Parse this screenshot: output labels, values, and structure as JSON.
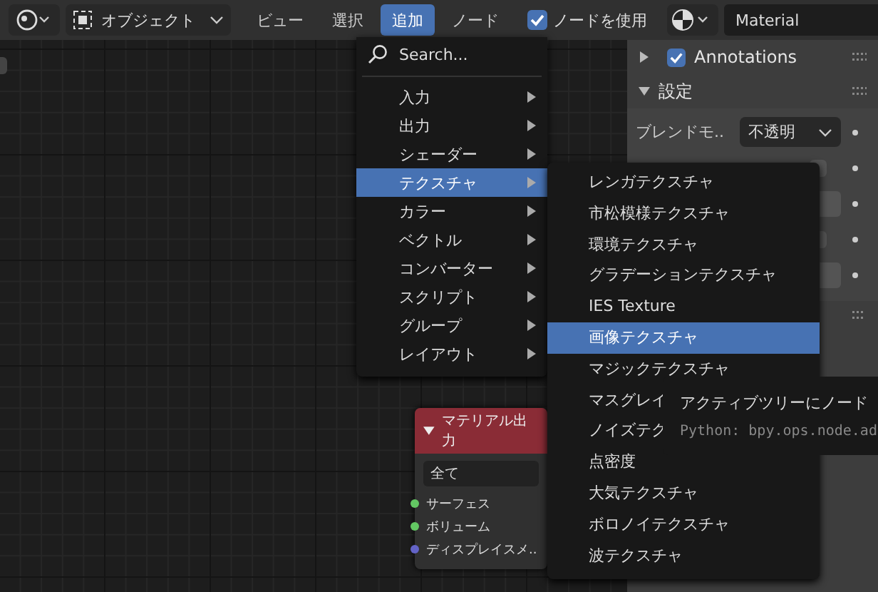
{
  "header": {
    "mode": "オブジェクト",
    "menus": [
      {
        "label": "ビュー",
        "selected": false
      },
      {
        "label": "選択",
        "selected": false
      },
      {
        "label": "追加",
        "selected": true
      },
      {
        "label": "ノード",
        "selected": false
      }
    ],
    "use_nodes": {
      "label": "ノードを使用",
      "checked": true
    },
    "material": {
      "value": "Material"
    }
  },
  "add_menu": {
    "search": "Search...",
    "items": [
      {
        "label": "入力",
        "selected": false
      },
      {
        "label": "出力",
        "selected": false
      },
      {
        "label": "シェーダー",
        "selected": false
      },
      {
        "label": "テクスチャ",
        "selected": true
      },
      {
        "label": "カラー",
        "selected": false
      },
      {
        "label": "ベクトル",
        "selected": false
      },
      {
        "label": "コンバーター",
        "selected": false
      },
      {
        "label": "スクリプト",
        "selected": false
      },
      {
        "label": "グループ",
        "selected": false
      },
      {
        "label": "レイアウト",
        "selected": false
      }
    ]
  },
  "submenu": {
    "items": [
      {
        "label": "レンガテクスチャ",
        "selected": false
      },
      {
        "label": "市松模様テクスチャ",
        "selected": false
      },
      {
        "label": "環境テクスチャ",
        "selected": false
      },
      {
        "label": "グラデーションテクスチャ",
        "selected": false
      },
      {
        "label": "IES Texture",
        "selected": false
      },
      {
        "label": "画像テクスチャ",
        "selected": true
      },
      {
        "label": "マジックテクスチャ",
        "selected": false
      },
      {
        "label": "マスグレイ",
        "selected": false
      },
      {
        "label": "ノイズテク",
        "selected": false
      },
      {
        "label": "点密度",
        "selected": false
      },
      {
        "label": "大気テクスチャ",
        "selected": false
      },
      {
        "label": "ボロノイテクスチャ",
        "selected": false
      },
      {
        "label": "波テクスチャ",
        "selected": false
      }
    ]
  },
  "tooltip": {
    "text": "アクティブツリーにノード",
    "python": "Python: bpy.ops.node.ad"
  },
  "node": {
    "title": "マテリアル出力",
    "dropdown": "全て",
    "sockets": [
      {
        "label": "サーフェス",
        "color": "#63c763"
      },
      {
        "label": "ボリューム",
        "color": "#63c763"
      },
      {
        "label": "ディスプレイスメ..",
        "color": "#6363c7"
      }
    ]
  },
  "sidebar": {
    "panels": [
      {
        "label": "Annotations",
        "expanded": false,
        "checked": true
      },
      {
        "label": "設定",
        "expanded": true
      }
    ],
    "blend_mode": {
      "label": "ブレンドモ..",
      "value": "不透明"
    }
  }
}
